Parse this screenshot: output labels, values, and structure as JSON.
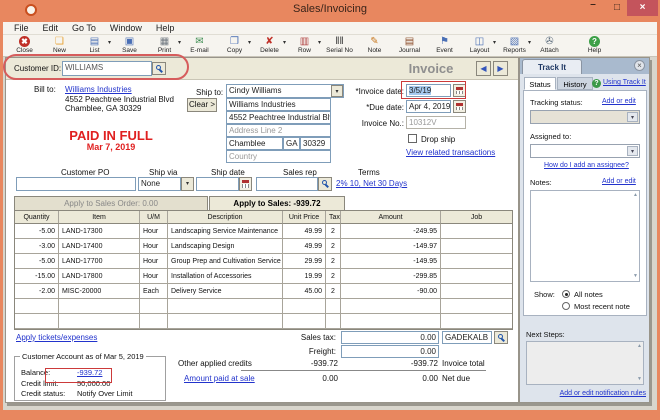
{
  "window": {
    "title": "Sales/Invoicing",
    "controls": {
      "minimize": "–",
      "maximize": "□",
      "close": "×"
    }
  },
  "menu": {
    "items": [
      "File",
      "Edit",
      "Go To",
      "Window",
      "Help"
    ]
  },
  "toolbar": {
    "items": [
      {
        "label": "Close",
        "icon": "close-icon",
        "glyph": "✖",
        "color": "#FFFFFF",
        "badge": "#C03028",
        "dropdown": false
      },
      {
        "label": "New",
        "icon": "new-icon",
        "glyph": "❏",
        "color": "#E8A030",
        "dropdown": false
      },
      {
        "label": "List",
        "icon": "list-icon",
        "glyph": "▤",
        "color": "#4A6FB5",
        "dropdown": true
      },
      {
        "label": "Save",
        "icon": "save-icon",
        "glyph": "▣",
        "color": "#4A6FB5",
        "dropdown": false
      },
      {
        "label": "Print",
        "icon": "print-icon",
        "glyph": "▦",
        "color": "#707880",
        "dropdown": true
      },
      {
        "label": "E-mail",
        "icon": "email-icon",
        "glyph": "✉",
        "color": "#3C8C50",
        "dropdown": false
      },
      {
        "label": "Copy",
        "icon": "copy-icon",
        "glyph": "❐",
        "color": "#4A6FB5",
        "dropdown": true
      },
      {
        "label": "Delete",
        "icon": "delete-icon",
        "glyph": "✘",
        "color": "#C03028",
        "dropdown": true
      },
      {
        "label": "Row",
        "icon": "row-icon",
        "glyph": "▥",
        "color": "#B04040",
        "dropdown": true
      },
      {
        "label": "Serial No",
        "icon": "serial-no-icon",
        "glyph": "‖‖",
        "color": "#303030",
        "dropdown": false
      },
      {
        "label": "Note",
        "icon": "note-icon",
        "glyph": "✎",
        "color": "#C87820",
        "dropdown": false
      },
      {
        "label": "Journal",
        "icon": "journal-icon",
        "glyph": "▤",
        "color": "#8A4A28",
        "dropdown": false
      },
      {
        "label": "Event",
        "icon": "event-icon",
        "glyph": "⚑",
        "color": "#4A6FB5",
        "dropdown": false
      },
      {
        "label": "Layout",
        "icon": "layout-icon",
        "glyph": "◫",
        "color": "#4A6FB5",
        "dropdown": true
      },
      {
        "label": "Reports",
        "icon": "reports-icon",
        "glyph": "▧",
        "color": "#4A6FB5",
        "dropdown": true
      },
      {
        "label": "Attach",
        "icon": "attach-icon",
        "glyph": "✇",
        "color": "#607080",
        "dropdown": false
      },
      {
        "label": "Help",
        "icon": "help-icon",
        "glyph": "?",
        "color": "#FFFFFF",
        "badge": "#3DA048",
        "dropdown": false
      }
    ]
  },
  "header": {
    "customer_id_label": "Customer ID:",
    "customer_id_value": "WILLIAMS",
    "form_title": "Invoice",
    "nav_prev": "◀",
    "nav_next": "▶"
  },
  "billto": {
    "label": "Bill to:",
    "name": "Williams Industries",
    "address1": "4552 Peachtree Industrial Blvd",
    "address2": "Chamblee, GA 30329"
  },
  "stamp": {
    "line1": "PAID IN FULL",
    "line2": "Mar 7, 2019"
  },
  "shipto": {
    "label": "Ship to:",
    "dropdown_value": "Cindy Williams",
    "clear_label": "Clear >",
    "name": "Williams Industries",
    "address1": "4552 Peachtree Industrial Blvd",
    "address2_placeholder": "Address Line 2",
    "city": "Chamblee",
    "state": "GA",
    "zip": "30329",
    "country_placeholder": "Country"
  },
  "invoice_fields": {
    "invoice_date_label": "*Invoice date:",
    "invoice_date": "3/5/19",
    "due_date_label": "*Due date:",
    "due_date": "Apr 4, 2019",
    "invoice_no_label": "Invoice No.:",
    "invoice_no": "10312V",
    "drop_ship_label": "Drop ship",
    "view_related_link": "View related transactions"
  },
  "order_row": {
    "customer_po_label": "Customer PO",
    "ship_via_label": "Ship via",
    "ship_via_value": "None",
    "ship_date_label": "Ship date",
    "sales_rep_label": "Sales rep",
    "terms_label": "Terms",
    "terms_link": "2% 10, Net 30 Days"
  },
  "tabs": {
    "sales_order": "Apply to Sales Order: 0.00",
    "sales": "Apply to Sales: -939.72"
  },
  "table": {
    "headers": [
      "Quantity",
      "Item",
      "U/M",
      "Description",
      "Unit Price",
      "Tax",
      "Amount",
      "Job"
    ],
    "rows": [
      {
        "quantity": "-5.00",
        "item": "LAND-17300",
        "um": "Hour",
        "description": "Landscaping Service Maintenance",
        "unit_price": "49.99",
        "tax": "2",
        "amount": "-249.95",
        "job": ""
      },
      {
        "quantity": "-3.00",
        "item": "LAND-17400",
        "um": "Hour",
        "description": "Landscaping Design",
        "unit_price": "49.99",
        "tax": "2",
        "amount": "-149.97",
        "job": ""
      },
      {
        "quantity": "-5.00",
        "item": "LAND-17700",
        "um": "Hour",
        "description": "Group Prep and Cultivation Service",
        "unit_price": "29.99",
        "tax": "2",
        "amount": "-149.95",
        "job": ""
      },
      {
        "quantity": "-15.00",
        "item": "LAND-17800",
        "um": "Hour",
        "description": "Installation of Accessories",
        "unit_price": "19.99",
        "tax": "2",
        "amount": "-299.85",
        "job": ""
      },
      {
        "quantity": "-2.00",
        "item": "MISC-20000",
        "um": "Each",
        "description": "Delivery Service",
        "unit_price": "45.00",
        "tax": "2",
        "amount": "-90.00",
        "job": ""
      }
    ]
  },
  "totals": {
    "apply_tickets_link": "Apply tickets/expenses",
    "sales_tax_label": "Sales tax:",
    "sales_tax_value": "0.00",
    "tax_code": "GADEKALB",
    "freight_label": "Freight:",
    "freight_value": "0.00",
    "other_credits_label": "Other applied credits",
    "other_credits_value": "-939.72",
    "invoice_total_value": "-939.72",
    "invoice_total_label": "Invoice total",
    "amount_paid_link": "Amount paid at sale",
    "amount_paid_value": "0.00",
    "net_due_value": "0.00",
    "net_due_label": "Net due"
  },
  "account": {
    "title": "Customer Account as of Mar 5, 2019",
    "balance_label": "Balance:",
    "balance_value": "-939.72",
    "credit_limit_label": "Credit limit:",
    "credit_limit_value": "50,000.00",
    "credit_status_label": "Credit status:",
    "credit_status_value": "Notify Over Limit"
  },
  "trackit": {
    "title": "Track It",
    "close": "×",
    "tab_status": "Status",
    "tab_history": "History",
    "using_link": "Using Track It",
    "tracking_status_label": "Tracking status:",
    "tracking_add_link": "Add or edit",
    "assigned_label": "Assigned to:",
    "assignee_help_link": "How do I add an assignee?",
    "notes_label": "Notes:",
    "notes_add_link": "Add or edit",
    "show_label": "Show:",
    "radio_all_notes": "All notes",
    "radio_most_recent": "Most recent note",
    "next_steps_label": "Next Steps:",
    "notification_link": "Add or edit notification rules"
  },
  "colors": {
    "titlebar": "#E8875F",
    "close_button": "#C4545C",
    "link_blue": "#2233CC",
    "stamp_red": "#E02020",
    "annotation_red": "#CC3A3A",
    "band_beige": "#ECE9D8",
    "trackit_bg": "#DEE4EC",
    "field_border": "#7F9DB9",
    "selection_blue": "#A6CAF0"
  }
}
